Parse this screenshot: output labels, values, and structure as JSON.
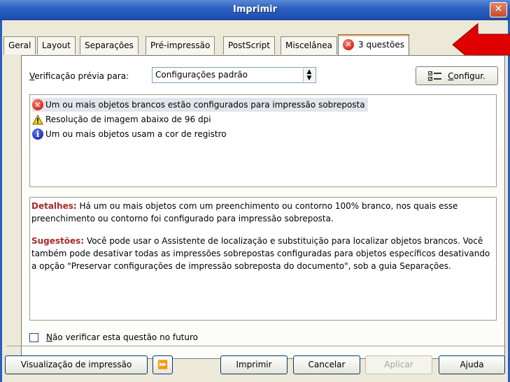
{
  "window": {
    "title": "Imprimir",
    "close_glyph": "✕"
  },
  "tabs": [
    {
      "label": "Geral"
    },
    {
      "label": "Layout"
    },
    {
      "label": "Separações"
    },
    {
      "label": "Pré-impressão"
    },
    {
      "label": "PostScript"
    },
    {
      "label": "Miscelânea"
    },
    {
      "label": "3 questões",
      "icon": "error-icon",
      "active": true
    }
  ],
  "verification": {
    "label_first": "V",
    "label_rest": "erificação prévia para:",
    "selected": "Configurações padrão"
  },
  "config_button": {
    "underline": "C",
    "rest": "onfigur."
  },
  "issues": [
    {
      "icon": "error-icon",
      "text": "Um ou mais objetos brancos estão configurados para impressão sobreposta",
      "selected": true
    },
    {
      "icon": "warning-icon",
      "text": "Resolução de imagem abaixo de 96 dpi"
    },
    {
      "icon": "info-icon",
      "text": "Um ou mais objetos usam a cor de registro"
    }
  ],
  "details": {
    "details_heading": "Detalhes:",
    "details_text": " Há um ou mais objetos com um preenchimento ou contorno 100% branco, nos quais esse preenchimento ou contorno foi configurado para impressão sobreposta.",
    "suggestions_heading": "Sugestões:",
    "suggestions_text": " Você pode usar o Assistente de localização e substituição para localizar objetos brancos. Você também pode desativar todas as impressões sobrepostas configuradas para objetos específicos desativando a opção \"Preservar configurações de impressão sobreposta do documento\", sob a guia Separações."
  },
  "checkbox": {
    "underline": "N",
    "rest": "ão verificar esta questão no futuro",
    "checked": false
  },
  "buttons": {
    "preview": "Visualização de impressão",
    "expand_glyph": "⏩",
    "print": "Imprimir",
    "cancel": "Cancelar",
    "apply": "Aplicar",
    "help": "Ajuda"
  },
  "colors": {
    "title_bar": "#2a5fc0",
    "arrow": "#e00000",
    "heading": "#a52a2a"
  }
}
